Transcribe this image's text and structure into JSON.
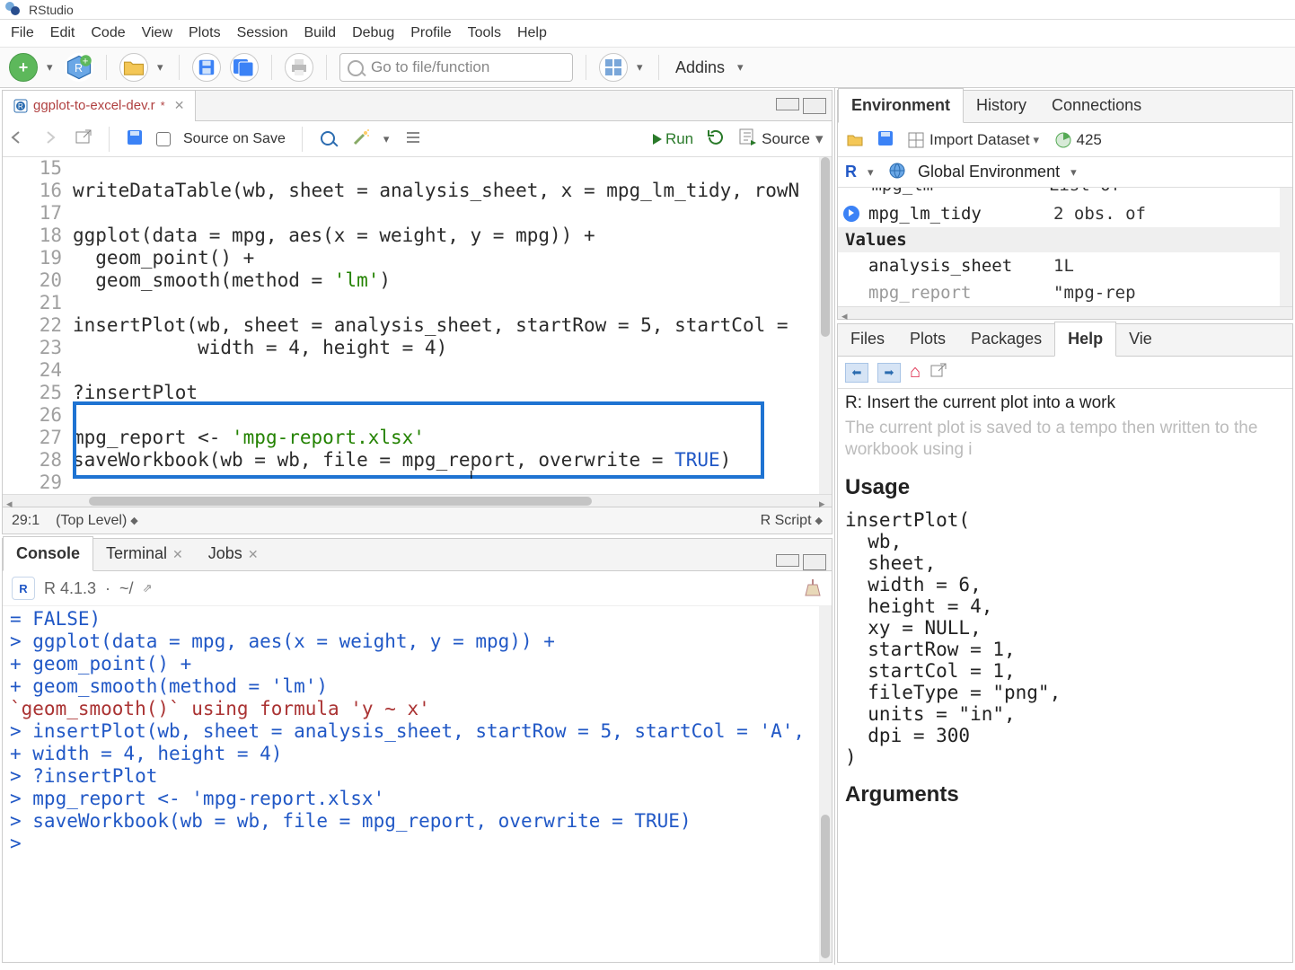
{
  "app": {
    "title": "RStudio"
  },
  "menu": [
    "File",
    "Edit",
    "Code",
    "View",
    "Plots",
    "Session",
    "Build",
    "Debug",
    "Profile",
    "Tools",
    "Help"
  ],
  "maintoolbar": {
    "search_placeholder": "Go to file/function",
    "addins_label": "Addins"
  },
  "source": {
    "tab_name": "ggplot-to-excel-dev.r",
    "dirty_marker": "*",
    "source_on_save_label": "Source on Save",
    "run_label": "Run",
    "source_label": "Source",
    "status_cursor": "29:1",
    "status_scope": "(Top Level)",
    "status_lang": "R Script",
    "lines": [
      {
        "n": "15",
        "t": ""
      },
      {
        "n": "16",
        "t": "writeDataTable(wb, sheet = analysis_sheet, x = mpg_lm_tidy, rowN"
      },
      {
        "n": "17",
        "t": ""
      },
      {
        "n": "18",
        "t": "ggplot(data = mpg, aes(x = weight, y = mpg)) +"
      },
      {
        "n": "19",
        "t": "  geom_point() +"
      },
      {
        "n": "20",
        "t": "  geom_smooth(method = 'lm')",
        "str": "'lm'"
      },
      {
        "n": "21",
        "t": ""
      },
      {
        "n": "22",
        "t": "insertPlot(wb, sheet = analysis_sheet, startRow = 5, startCol ="
      },
      {
        "n": "23",
        "t": "           width = 4, height = 4)"
      },
      {
        "n": "24",
        "t": ""
      },
      {
        "n": "25",
        "t": "?insertPlot"
      },
      {
        "n": "26",
        "t": ""
      },
      {
        "n": "27",
        "t": "mpg_report <- 'mpg-report.xlsx'",
        "str": "'mpg-report.xlsx'"
      },
      {
        "n": "28",
        "t": "saveWorkbook(wb = wb, file = mpg_report, overwrite = TRUE)",
        "const": "TRUE"
      },
      {
        "n": "29",
        "t": ""
      }
    ]
  },
  "console": {
    "tabs": {
      "console": "Console",
      "terminal": "Terminal",
      "jobs": "Jobs"
    },
    "version": "R 4.1.3",
    "cwd": "~/",
    "lines": [
      {
        "cls": "p-blue",
        "t": "= FALSE)"
      },
      {
        "cls": "p-blue",
        "t": "> ggplot(data = mpg, aes(x = weight, y = mpg)) +"
      },
      {
        "cls": "p-blue",
        "t": "+   geom_point() +"
      },
      {
        "cls": "p-blue",
        "t": "+   geom_smooth(method = 'lm')"
      },
      {
        "cls": "p-msg",
        "t": "`geom_smooth()` using formula 'y ~ x'"
      },
      {
        "cls": "p-blue",
        "t": "> insertPlot(wb, sheet = analysis_sheet, startRow = 5, startCol = 'A',"
      },
      {
        "cls": "p-blue",
        "t": "+            width = 4, height = 4)"
      },
      {
        "cls": "p-blue",
        "t": "> ?insertPlot"
      },
      {
        "cls": "p-blue",
        "t": "> mpg_report <- 'mpg-report.xlsx'"
      },
      {
        "cls": "p-blue",
        "t": "> saveWorkbook(wb = wb, file = mpg_report, overwrite = TRUE)"
      },
      {
        "cls": "p-blue",
        "t": "> "
      }
    ]
  },
  "right_top": {
    "tabs": [
      "Environment",
      "History",
      "Connections"
    ],
    "import_label": "Import Dataset",
    "mem_label": "425",
    "r_label": "R",
    "scope_label": "Global Environment",
    "cut_row_name": "mpg_lm",
    "cut_row_val": "List of",
    "rows": [
      {
        "play": true,
        "name": "mpg_lm_tidy",
        "val": "2 obs. of"
      }
    ],
    "values_header": "Values",
    "value_rows": [
      {
        "name": "analysis_sheet",
        "val": "1L"
      },
      {
        "name": "mpg_report",
        "val": "\"mpg-rep",
        "faded": true
      }
    ]
  },
  "right_bottom": {
    "tabs": [
      "Files",
      "Plots",
      "Packages",
      "Help",
      "Vie"
    ],
    "title": "R: Insert the current plot into a work",
    "blurb": "The current plot is saved to a tempo then written to the workbook using i",
    "usage_heading": "Usage",
    "usage_code": "insertPlot(\n  wb,\n  sheet,\n  width = 6,\n  height = 4,\n  xy = NULL,\n  startRow = 1,\n  startCol = 1,\n  fileType = \"png\",\n  units = \"in\",\n  dpi = 300\n)",
    "arguments_heading": "Arguments"
  }
}
